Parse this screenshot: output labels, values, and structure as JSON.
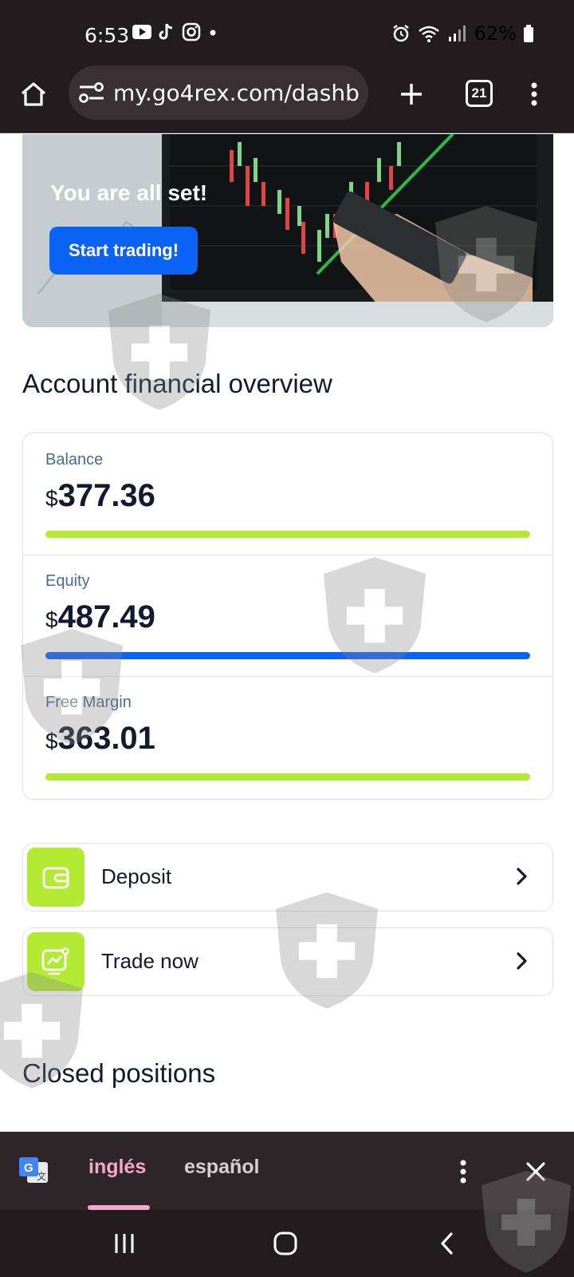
{
  "status_bar": {
    "time": "6:53",
    "battery": "62%",
    "notification_icons": [
      "youtube-icon",
      "tiktok-icon",
      "instagram-icon",
      "dot-icon"
    ],
    "system_icons": [
      "alarm-icon",
      "wifi-icon",
      "signal-icon",
      "battery-icon"
    ]
  },
  "browser": {
    "url": "my.go4rex.com/dashb",
    "tab_count": "21"
  },
  "hero": {
    "title": "You are all set!",
    "button_label": "Start trading!"
  },
  "overview": {
    "title": "Account financial overview",
    "currency": "$",
    "metrics": [
      {
        "label": "Balance",
        "value": "377.36",
        "bar_color": "#b2ea34"
      },
      {
        "label": "Equity",
        "value": "487.49",
        "bar_color": "#0a63f5"
      },
      {
        "label": "Free Margin",
        "value": "363.01",
        "bar_color": "#b2ea34"
      }
    ]
  },
  "actions": [
    {
      "label": "Deposit",
      "icon": "wallet-icon"
    },
    {
      "label": "Trade now",
      "icon": "chart-icon"
    }
  ],
  "closed_positions": {
    "title": "Closed positions"
  },
  "translate_bar": {
    "source_lang": "inglés",
    "target_lang": "español",
    "active_color": "#f5a9c6"
  },
  "colors": {
    "accent_green": "#b2ea34",
    "accent_blue": "#0a63f5",
    "dark_chrome": "#231c1e"
  }
}
